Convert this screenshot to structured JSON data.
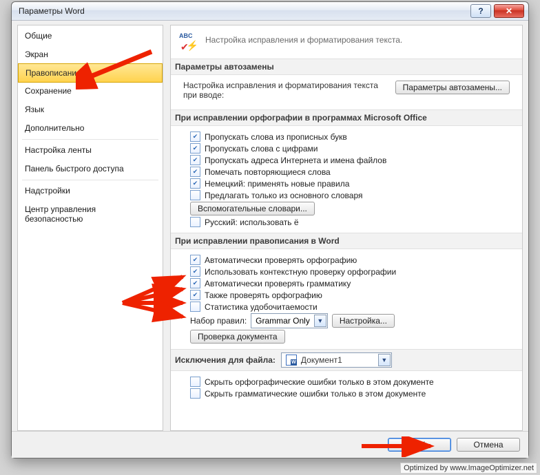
{
  "window": {
    "title": "Параметры Word"
  },
  "titlebar": {
    "help": "?",
    "close": "✕"
  },
  "sidebar": {
    "items": [
      "Общие",
      "Экран",
      "Правописание",
      "Сохранение",
      "Язык",
      "Дополнительно",
      "Настройка ленты",
      "Панель быстрого доступа",
      "Надстройки",
      "Центр управления безопасностью"
    ],
    "selected_index": 2
  },
  "header": {
    "text": "Настройка исправления и форматирования текста."
  },
  "sections": {
    "autocorrect": {
      "title": "Параметры автозамены",
      "text": "Настройка исправления и форматирования текста при вводе:",
      "button": "Параметры автозамены..."
    },
    "ms_spell": {
      "title": "При исправлении орфографии в программах Microsoft Office",
      "checks": [
        {
          "label": "Пропускать слова из прописных букв",
          "checked": true
        },
        {
          "label": "Пропускать слова с цифрами",
          "checked": true
        },
        {
          "label": "Пропускать адреса Интернета и имена файлов",
          "checked": true
        },
        {
          "label": "Помечать повторяющиеся слова",
          "checked": true
        },
        {
          "label": "Немецкий: применять новые правила",
          "checked": true
        },
        {
          "label": "Предлагать только из основного словаря",
          "checked": false
        }
      ],
      "dict_button": "Вспомогательные словари...",
      "russian_e": {
        "label": "Русский: использовать ё",
        "checked": false
      }
    },
    "word_spell": {
      "title": "При исправлении правописания в Word",
      "checks": [
        {
          "label": "Автоматически проверять орфографию",
          "checked": true
        },
        {
          "label": "Использовать контекстную проверку орфографии",
          "checked": true
        },
        {
          "label": "Автоматически проверять грамматику",
          "checked": true
        },
        {
          "label": "Также проверять орфографию",
          "checked": true
        },
        {
          "label": "Статистика удобочитаемости",
          "checked": false
        }
      ],
      "ruleset_label": "Набор правил:",
      "ruleset_value": "Grammar Only",
      "ruleset_settings": "Настройка...",
      "check_doc": "Проверка документа"
    },
    "exceptions": {
      "title": "Исключения для файла:",
      "doc_name": "Документ1",
      "checks": [
        {
          "label": "Скрыть орфографические ошибки только в этом документе",
          "checked": false
        },
        {
          "label": "Скрыть грамматические ошибки только в этом документе",
          "checked": false
        }
      ]
    }
  },
  "footer": {
    "ok": "ОК",
    "cancel": "Отмена"
  },
  "watermark": "Optimized by www.ImageOptimizer.net"
}
